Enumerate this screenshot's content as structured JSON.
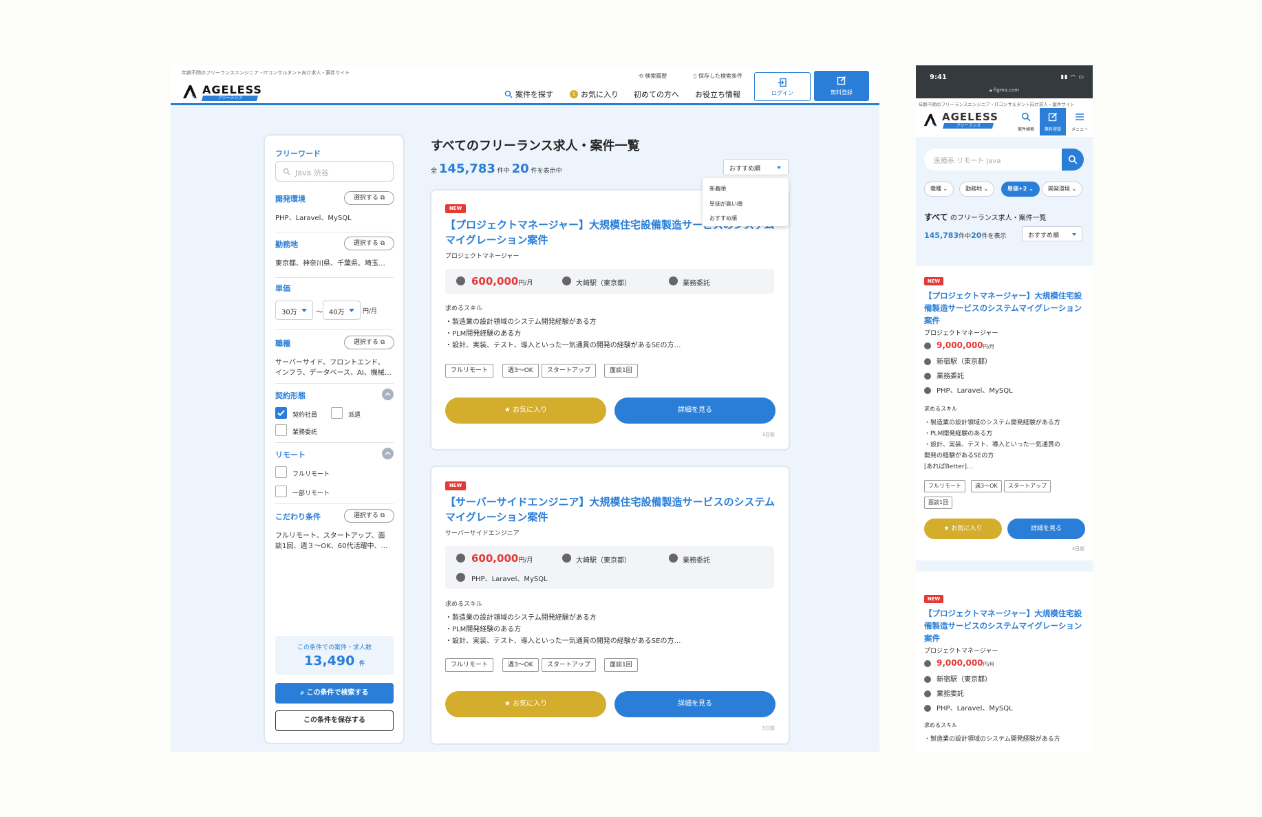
{
  "colors": {
    "accent": "#2a7ed8",
    "price": "#e53935",
    "favorite": "#d4ad2c",
    "new_badge": "#e53935"
  },
  "desktop": {
    "tagline": "年齢不問のフリーランスエンジニア・ITコンサルタント向け求人・案件サイト",
    "logo": {
      "word": "AGELESS",
      "sub": "フリーランス"
    },
    "top_links": [
      "検索履歴",
      "保存した検索条件"
    ],
    "nav": [
      "案件を探す",
      "お気に入り",
      "初めての方へ",
      "お役立ち情報"
    ],
    "fav_count": "1",
    "login": "ログイン",
    "register": "無料登録",
    "sidebar": {
      "freeword_label": "フリーワード",
      "freeword_placeholder": "Java 渋谷",
      "dev_env_label": "開発環境",
      "dev_env_value": "PHP、Laravel、MySQL",
      "location_label": "勤務地",
      "location_value": "東京都、神奈川県、千葉県、埼玉…",
      "price_label": "単価",
      "price_min": "30万",
      "price_sep": "〜",
      "price_max": "40万",
      "price_unit": "円/月",
      "job_label": "職種",
      "job_value_1": "サーバーサイド、フロントエンド、",
      "job_value_2": "インフラ、データベース、AI、機械…",
      "select_label": "選択する",
      "contract_label": "契約形態",
      "contract_options": [
        {
          "label": "契約社員",
          "checked": true
        },
        {
          "label": "派遣",
          "checked": false
        },
        {
          "label": "業務委託",
          "checked": false
        }
      ],
      "remote_label": "リモート",
      "remote_options": [
        {
          "label": "フルリモート",
          "checked": false
        },
        {
          "label": "一部リモート",
          "checked": false
        }
      ],
      "kodawari_label": "こだわり条件",
      "kodawari_value_1": "フルリモート、スタートアップ、面",
      "kodawari_value_2": "談1回、週３〜OK、60代活躍中、…",
      "count_label": "この条件での案件・求人数",
      "count_value": "13,490",
      "count_unit": "件",
      "search_btn": "この条件で検索する",
      "save_btn": "この条件を保存する"
    },
    "main": {
      "title": "すべてのフリーランス求人・案件一覧",
      "count_prefix": "全",
      "count_total": "145,783",
      "count_mid": "件中",
      "count_shown": "20",
      "count_suffix": "件を表示中",
      "sort_selected": "おすすめ順",
      "sort_options": [
        "新着順",
        "単価が高い順",
        "おすすめ順"
      ]
    },
    "cards": [
      {
        "badge": "NEW",
        "title": "【プロジェクトマネージャー】大規模住宅設備製造サービスのシステムマイグレーション案件",
        "role": "プロジェクトマネージャー",
        "price": "600,000",
        "price_unit": "円/月",
        "station": "大崎駅（東京都）",
        "contract": "業務委託",
        "skill_label": "求めるスキル",
        "skills": [
          "・製造業の設計領域のシステム開発経験がある方",
          "・PLM開発経験のある方",
          "・設計、実装、テスト、導入といった一気通貫の開発の経験があるSEの方…"
        ],
        "tags": [
          "フルリモート",
          "週3〜OK",
          "スタートアップ",
          "面談1回"
        ],
        "fav": "お気に入り",
        "detail": "詳細を見る",
        "ago": "3日前"
      },
      {
        "badge": "NEW",
        "title": "【サーバーサイドエンジニア】大規模住宅設備製造サービスのシステムマイグレーション案件",
        "role": "サーバーサイドエンジニア",
        "price": "600,000",
        "price_unit": "円/月",
        "station": "大崎駅（東京都）",
        "contract": "業務委託",
        "tech": "PHP、Laravel、MySQL",
        "skill_label": "求めるスキル",
        "skills": [
          "・製造業の設計領域のシステム開発経験がある方",
          "・PLM開発経験のある方",
          "・設計、実装、テスト、導入といった一気通貫の開発の経験があるSEの方…"
        ],
        "tags": [
          "フルリモート",
          "週3〜OK",
          "スタートアップ",
          "面談1回"
        ],
        "fav": "お気に入り",
        "detail": "詳細を見る",
        "ago": "3日前"
      }
    ]
  },
  "mobile": {
    "time": "9:41",
    "url": "figma.com",
    "tagline": "年齢不問のフリーランスエンジニア・ITコンサルタント向け求人・案件サイト",
    "nav": [
      "案件検索",
      "無料登録",
      "メニュー"
    ],
    "search_placeholder": "医療系 リモート Java",
    "chips": [
      "職種",
      "勤務地",
      "単価+2",
      "開発環境"
    ],
    "heading_bold": "すべて",
    "heading_rest": "のフリーランス求人・案件一覧",
    "count_total": "145,783",
    "count_mid": "件中",
    "count_shown": "20",
    "count_suffix": "件を表示",
    "sort": "おすすめ順",
    "cards": [
      {
        "badge": "NEW",
        "title": "【プロジェクトマネージャー】大規模住宅設備製造サービスのシステムマイグレーション案件",
        "role": "プロジェクトマネージャー",
        "price": "9,000,000",
        "price_unit": "円/月",
        "station": "新宿駅（東京都）",
        "contract": "業務委託",
        "tech": "PHP、Laravel、MySQL",
        "skill_label": "求めるスキル",
        "skills": [
          "・製造業の設計領域のシステム開発経験がある方",
          "・PLM開発経験のある方",
          "・設計、実装、テスト、導入といった一気通貫の",
          "開発の経験があるSEの方",
          "[あればBetter]…"
        ],
        "tags": [
          "フルリモート",
          "週3〜OK",
          "スタートアップ",
          "面談1回"
        ],
        "fav": "お気に入り",
        "detail": "詳細を見る",
        "ago": "3日前"
      },
      {
        "badge": "NEW",
        "title": "【プロジェクトマネージャー】大規模住宅設備製造サービスのシステムマイグレーション案件",
        "role": "プロジェクトマネージャー",
        "price": "9,000,000",
        "price_unit": "円/月",
        "station": "新宿駅（東京都）",
        "contract": "業務委託",
        "tech": "PHP、Laravel、MySQL",
        "skill_label": "求めるスキル",
        "skills": [
          "・製造業の設計領域のシステム開発経験がある方"
        ]
      }
    ]
  }
}
